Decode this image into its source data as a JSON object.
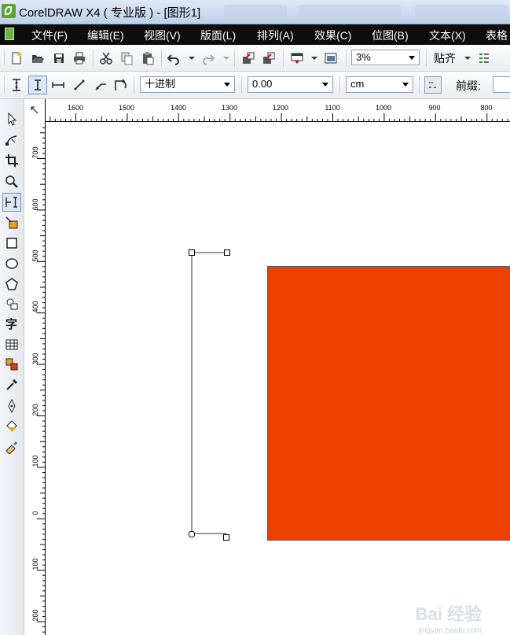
{
  "window": {
    "title": "CorelDRAW X4 ( 专业版 ) - [图形1]"
  },
  "menu": [
    {
      "label": "文件(F)"
    },
    {
      "label": "编辑(E)"
    },
    {
      "label": "视图(V)"
    },
    {
      "label": "版面(L)"
    },
    {
      "label": "排列(A)"
    },
    {
      "label": "效果(C)"
    },
    {
      "label": "位图(B)"
    },
    {
      "label": "文本(X)"
    },
    {
      "label": "表格"
    }
  ],
  "standard_toolbar": {
    "icons": [
      "new-icon",
      "open-icon",
      "save-icon",
      "print-icon",
      "cut-icon",
      "copy-icon",
      "paste-icon",
      "undo-icon",
      "redo-icon",
      "import-icon",
      "export-icon",
      "application-launcher-icon",
      "welcome-screen-icon"
    ],
    "zoom_level": "3%",
    "snap_label": "贴齐",
    "options_icon": "options-icon"
  },
  "property_bar": {
    "dimension_tools": [
      "vertical-dimension-icon",
      "horizontal-dimension-icon",
      "slanted-dimension-icon",
      "segment-dimension-icon",
      "angular-dimension-icon"
    ],
    "style_value": "十进制",
    "precision_value": "0.00",
    "units_value": "cm",
    "prefix_label": "前缀:"
  },
  "toolbox": [
    "pick-tool-icon",
    "shape-tool-icon",
    "crop-tool-icon",
    "zoom-tool-icon",
    "dimension-tool-icon",
    "smart-fill-icon",
    "rectangle-tool-icon",
    "ellipse-tool-icon",
    "polygon-tool-icon",
    "basic-shapes-icon",
    "text-tool-icon",
    "table-tool-icon",
    "interactive-tool-icon",
    "eyedropper-icon",
    "outline-pen-icon",
    "fill-tool-icon",
    "interactive-fill-icon"
  ],
  "toolbox_text_glyph": "字",
  "rulers": {
    "horizontal": [
      "1600",
      "1500",
      "1400",
      "1300",
      "1200",
      "1100",
      "1000",
      "900",
      "800"
    ],
    "vertical": [
      "700",
      "600",
      "500",
      "400",
      "300",
      "200",
      "100",
      "0",
      "100",
      "200"
    ]
  },
  "canvas": {
    "rectangle_fill": "#EC3F00",
    "rectangle_outline": "#555555",
    "dimension_line_color": "#333333"
  },
  "watermark": {
    "text": "Bai 经验",
    "url": "jingyan.baidu.com"
  },
  "colors": {
    "menu_bg": "#0d0d0d",
    "menu_text": "#ffffff",
    "title_bg": "#c9d9ee"
  }
}
